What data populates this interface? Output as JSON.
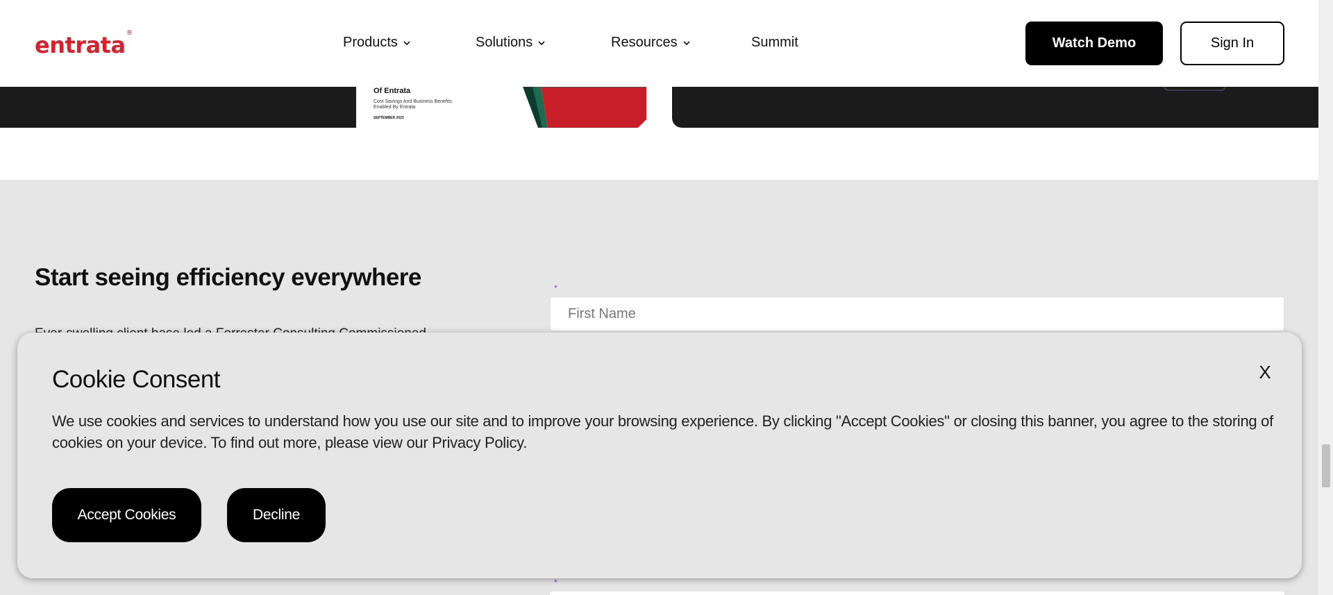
{
  "header": {
    "logo_text": "entrata",
    "logo_mark": "®",
    "nav": [
      {
        "label": "Products",
        "has_dropdown": true
      },
      {
        "label": "Solutions",
        "has_dropdown": true
      },
      {
        "label": "Resources",
        "has_dropdown": true
      },
      {
        "label": "Summit",
        "has_dropdown": false
      }
    ],
    "watch_demo_label": "Watch Demo",
    "sign_in_label": "Sign In"
  },
  "report": {
    "title": "Of Entrata",
    "subtitle": "Cost Savings And Business Benefits Enabled By Entrata",
    "date": "SEPTEMBER 2023"
  },
  "section": {
    "headline": "Start seeing efficiency everywhere",
    "body_peek": "Ever-swelling client base led a Forrester Consulting Commissioned",
    "required_marker": "*",
    "first_name_placeholder": "First Name"
  },
  "cookie": {
    "title": "Cookie Consent",
    "close_label": "X",
    "text": "We use cookies and services to understand how you use our site and to improve your browsing experience. By clicking \"Accept Cookies\" or closing this banner, you agree to the storing of cookies on your device. To find out more, please view our Privacy Policy.",
    "accept_label": "Accept Cookies",
    "decline_label": "Decline"
  },
  "colors": {
    "brand_red": "#d7212f",
    "dark_band": "#1b1b1b",
    "section_gray": "#e6e6e6",
    "button_black": "#000000"
  }
}
